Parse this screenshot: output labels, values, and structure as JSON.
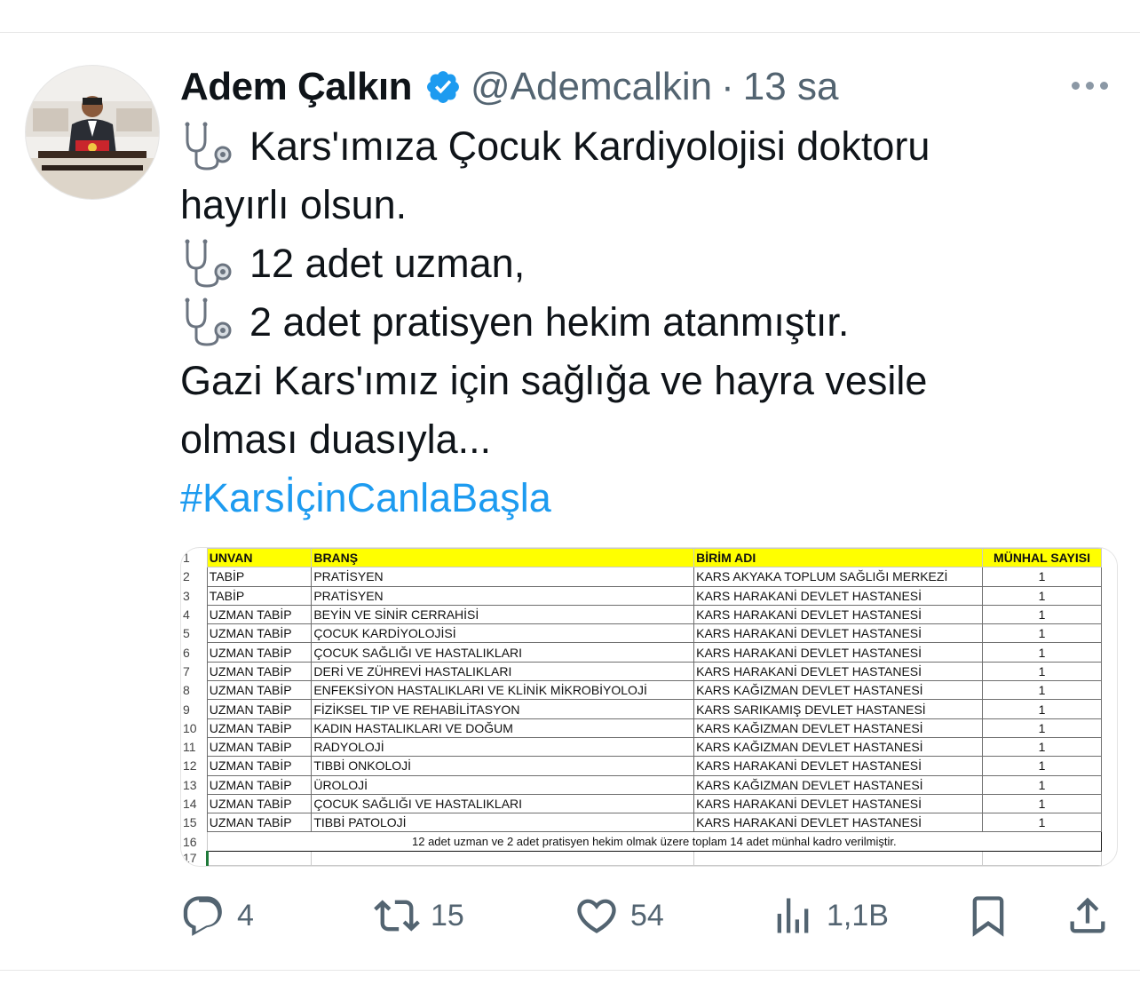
{
  "author": {
    "name": "Adem Çalkın",
    "handle": "@Ademcalkin",
    "separator": "·",
    "time": "13 sa"
  },
  "tweet": {
    "line1": "Kars'ımıza Çocuk Kardiyolojisi doktoru",
    "line2": "hayırlı olsun.",
    "line3": "12 adet uzman,",
    "line4": "2 adet pratisyen hekim atanmıştır.",
    "line5": "Gazi Kars'ımız için sağlığa ve hayra vesile",
    "line6": "olması duasıyla...",
    "hashtag": "#KarsİçinCanlaBaşla"
  },
  "sheet": {
    "header": {
      "rownum": "1",
      "unvan": "UNVAN",
      "brans": "BRANŞ",
      "birim": "BİRİM ADI",
      "munhal": "MÜNHAL SAYISI"
    },
    "rows": [
      {
        "rownum": "2",
        "unvan": "TABİP",
        "brans": "PRATİSYEN",
        "birim": "KARS AKYAKA TOPLUM SAĞLIĞI MERKEZİ",
        "munhal": "1"
      },
      {
        "rownum": "3",
        "unvan": "TABİP",
        "brans": "PRATİSYEN",
        "birim": "KARS HARAKANİ DEVLET HASTANESİ",
        "munhal": "1"
      },
      {
        "rownum": "4",
        "unvan": "UZMAN TABİP",
        "brans": "BEYİN VE SİNİR CERRAHİSİ",
        "birim": "KARS HARAKANİ DEVLET HASTANESİ",
        "munhal": "1"
      },
      {
        "rownum": "5",
        "unvan": "UZMAN TABİP",
        "brans": "ÇOCUK KARDİYOLOJİSİ",
        "birim": "KARS HARAKANİ DEVLET HASTANESİ",
        "munhal": "1"
      },
      {
        "rownum": "6",
        "unvan": "UZMAN TABİP",
        "brans": "ÇOCUK SAĞLIĞI VE HASTALIKLARI",
        "birim": "KARS HARAKANİ DEVLET HASTANESİ",
        "munhal": "1"
      },
      {
        "rownum": "7",
        "unvan": "UZMAN TABİP",
        "brans": "DERİ VE ZÜHREVİ HASTALIKLARI",
        "birim": "KARS HARAKANİ DEVLET HASTANESİ",
        "munhal": "1"
      },
      {
        "rownum": "8",
        "unvan": "UZMAN TABİP",
        "brans": "ENFEKSİYON HASTALIKLARI VE KLİNİK MİKROBİYOLOJİ",
        "birim": "KARS KAĞIZMAN DEVLET HASTANESİ",
        "munhal": "1"
      },
      {
        "rownum": "9",
        "unvan": "UZMAN TABİP",
        "brans": "FİZİKSEL TIP VE REHABİLİTASYON",
        "birim": "KARS SARIKAMIŞ DEVLET HASTANESİ",
        "munhal": "1"
      },
      {
        "rownum": "10",
        "unvan": "UZMAN TABİP",
        "brans": "KADIN HASTALIKLARI VE DOĞUM",
        "birim": "KARS KAĞIZMAN DEVLET HASTANESİ",
        "munhal": "1"
      },
      {
        "rownum": "11",
        "unvan": "UZMAN TABİP",
        "brans": "RADYOLOJİ",
        "birim": "KARS KAĞIZMAN DEVLET HASTANESİ",
        "munhal": "1"
      },
      {
        "rownum": "12",
        "unvan": "UZMAN TABİP",
        "brans": "TIBBİ ONKOLOJİ",
        "birim": "KARS HARAKANİ DEVLET HASTANESİ",
        "munhal": "1"
      },
      {
        "rownum": "13",
        "unvan": "UZMAN TABİP",
        "brans": "ÜROLOJİ",
        "birim": "KARS KAĞIZMAN DEVLET HASTANESİ",
        "munhal": "1"
      },
      {
        "rownum": "14",
        "unvan": "UZMAN TABİP",
        "brans": "ÇOCUK SAĞLIĞI VE HASTALIKLARI",
        "birim": "KARS HARAKANİ DEVLET HASTANESİ",
        "munhal": "1"
      },
      {
        "rownum": "15",
        "unvan": "UZMAN TABİP",
        "brans": "TIBBİ PATOLOJİ",
        "birim": "KARS HARAKANİ DEVLET HASTANESİ",
        "munhal": "1"
      }
    ],
    "footer": {
      "rownum": "16",
      "text": "12 adet uzman ve 2 adet pratisyen hekim olmak üzere toplam 14 adet münhal kadro verilmiştir."
    },
    "last_rownum": "17"
  },
  "actions": {
    "reply_count": "4",
    "retweet_count": "15",
    "like_count": "54",
    "views_count": "1,1B"
  },
  "colors": {
    "link": "#1d9bf0",
    "muted": "#536471",
    "verified": "#1d9bf0",
    "sheet_header": "#ffff00"
  },
  "icons": [
    "verified-badge-icon",
    "more-icon",
    "stethoscope-icon",
    "reply-icon",
    "retweet-icon",
    "like-icon",
    "views-icon",
    "bookmark-icon",
    "share-icon"
  ]
}
